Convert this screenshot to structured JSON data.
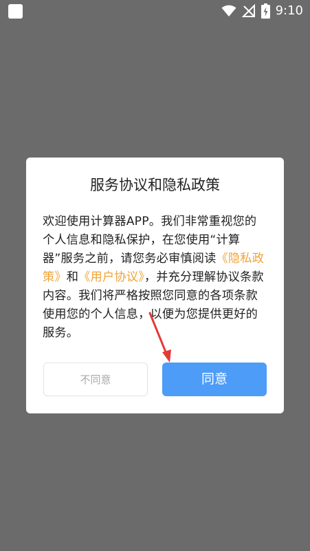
{
  "status_bar": {
    "time": "9:10",
    "icons": [
      "wifi-icon",
      "no-signal-icon",
      "battery-charging-icon"
    ]
  },
  "dialog": {
    "title": "服务协议和隐私政策",
    "body_intro": "欢迎使用计算器APP。我们非常重视您的个人信息和隐私保护，在您使用“计算器”服务之前，请您务必审慎阅读",
    "privacy_link": "《隐私政策》",
    "and_text": "和",
    "user_agreement_link": "《用户协议》",
    "body_outro": "，并充分理解协议条款内容。我们将严格按照您同意的各项条款使用您的个人信息，以便为您提供更好的服务。",
    "disagree_label": "不同意",
    "agree_label": "同意"
  },
  "colors": {
    "overlay": "#6b6b6b",
    "link": "#f0a335",
    "agree_button": "#4d9cf7",
    "annotation_arrow": "#e53935"
  }
}
